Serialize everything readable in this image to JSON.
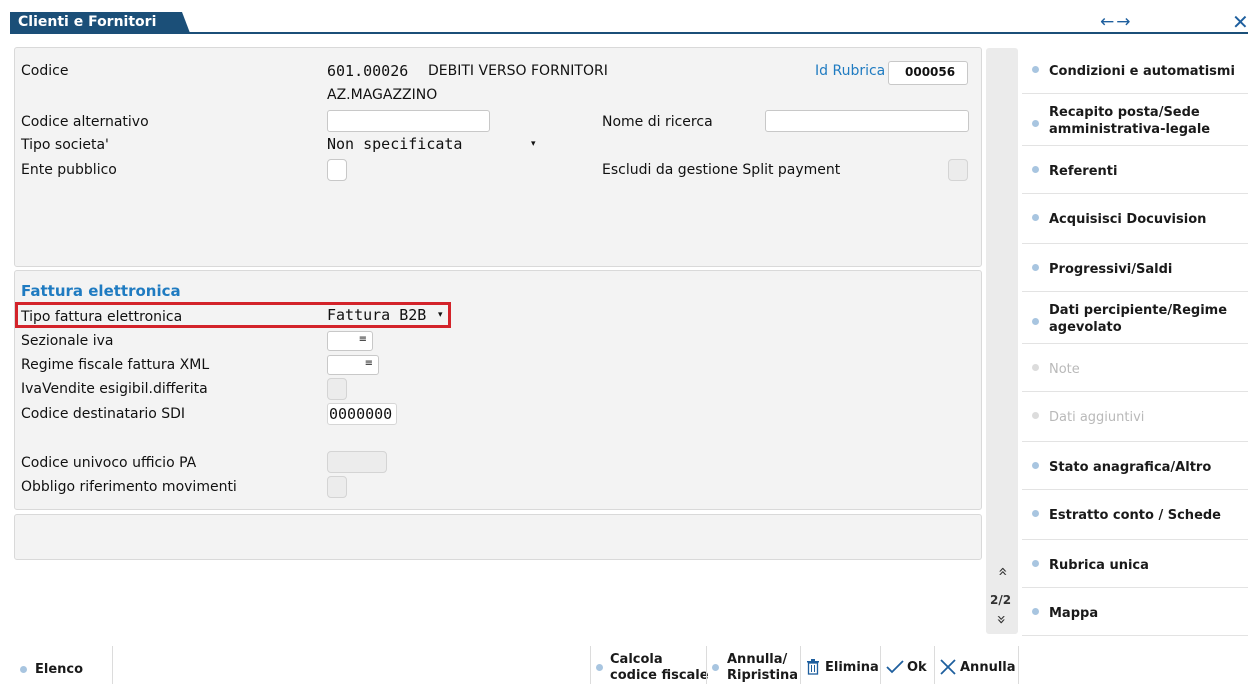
{
  "window": {
    "title": "Clienti e Fornitori",
    "nav_arrows": "←→",
    "close_glyph": "✕"
  },
  "header": {
    "codice_label": "Codice",
    "codice_value": "601.00026",
    "descrizione_line1": "DEBITI VERSO FORNITORI",
    "descrizione_line2": "AZ.MAGAZZINO",
    "id_rubrica_label": "Id Rubrica",
    "id_rubrica_value": "000056",
    "codice_alternativo_label": "Codice alternativo",
    "codice_alternativo_value": "",
    "nome_ricerca_label": "Nome di ricerca",
    "nome_ricerca_value": "",
    "tipo_societa_label": "Tipo societa'",
    "tipo_societa_value": "Non specificata",
    "ente_pubblico_label": "Ente pubblico",
    "split_payment_label": "Escludi da gestione Split payment"
  },
  "fattura": {
    "section_title": "Fattura elettronica",
    "tipo_label": "Tipo fattura elettronica",
    "tipo_value": "Fattura B2B",
    "sezionale_label": "Sezionale iva",
    "regime_label": "Regime fiscale fattura XML",
    "iva_esig_label": "IvaVendite esigibil.differita",
    "codice_sdi_label": "Codice destinatario SDI",
    "codice_sdi_value": "0000000",
    "codice_ufficio_label": "Codice univoco ufficio PA",
    "obbligo_label": "Obbligo riferimento movimenti"
  },
  "pager": {
    "up": "»",
    "page": "2/2",
    "down": "»"
  },
  "side_menu": [
    {
      "line1": "Condizioni e automatismi",
      "line2": "",
      "enabled": true
    },
    {
      "line1": "Recapito posta/Sede",
      "line2": "amministrativa-legale",
      "enabled": true
    },
    {
      "line1": "Referenti",
      "line2": "",
      "enabled": true
    },
    {
      "line1": "Acquisisci Docuvision",
      "line2": "",
      "enabled": true
    },
    {
      "line1": "Progressivi/Saldi",
      "line2": "",
      "enabled": true
    },
    {
      "line1": "Dati percipiente/Regime",
      "line2": "agevolato",
      "enabled": true
    },
    {
      "line1": "Note",
      "line2": "",
      "enabled": false
    },
    {
      "line1": "Dati aggiuntivi",
      "line2": "",
      "enabled": false
    },
    {
      "line1": "Stato anagrafica/Altro",
      "line2": "",
      "enabled": true
    },
    {
      "line1": "Estratto conto / Schede",
      "line2": "",
      "enabled": true
    },
    {
      "line1": "Rubrica unica",
      "line2": "",
      "enabled": true
    },
    {
      "line1": "Mappa",
      "line2": "",
      "enabled": true
    }
  ],
  "toolbar": {
    "elenco": "Elenco",
    "calcola_line1": "Calcola",
    "calcola_line2": "codice fiscale",
    "annulla_ripristina_line1": "Annulla/",
    "annulla_ripristina_line2": "Ripristina",
    "elimina": "Elimina",
    "ok": "Ok",
    "annulla": "Annulla"
  },
  "colors": {
    "accent": "#1b4f78",
    "link_blue": "#1f7bc1",
    "highlight_red": "#d3232a"
  },
  "icons": {
    "trash": "trash-icon",
    "check": "check-icon",
    "cross": "cross-icon"
  }
}
